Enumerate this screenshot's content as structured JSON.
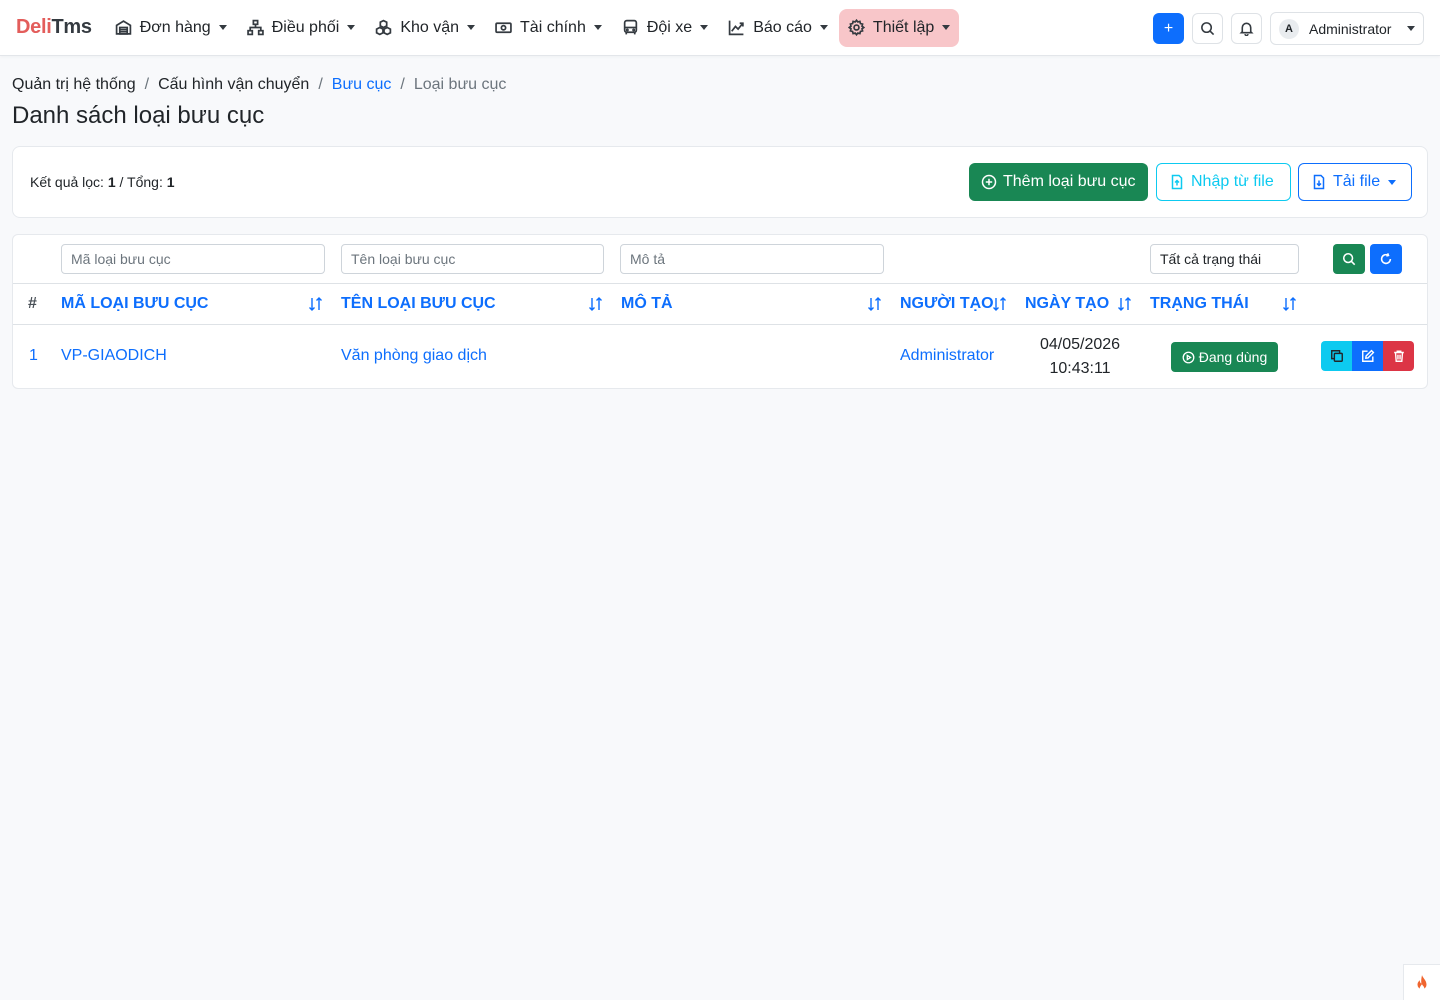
{
  "brand": {
    "part1": "Deli",
    "part2": "Tms"
  },
  "nav": {
    "items": [
      {
        "label": "Đơn hàng",
        "icon": "warehouse-icon"
      },
      {
        "label": "Điều phối",
        "icon": "hierarchy-icon"
      },
      {
        "label": "Kho vận",
        "icon": "boxes-icon"
      },
      {
        "label": "Tài chính",
        "icon": "cash-icon"
      },
      {
        "label": "Đội xe",
        "icon": "bus-icon"
      },
      {
        "label": "Báo cáo",
        "icon": "chart-icon"
      },
      {
        "label": "Thiết lập",
        "icon": "gear-icon",
        "active": true
      }
    ],
    "plus_label": "+",
    "user": {
      "avatar_letter": "A",
      "name": "Administrator"
    }
  },
  "breadcrumb": {
    "items": [
      "Quản trị hệ thống",
      "Cấu hình vận chuyển",
      "Bưu cục",
      "Loại bưu cục"
    ],
    "separator": "/"
  },
  "page_title": "Danh sách loại bưu cục",
  "toolbar": {
    "result_label": "Kết quả lọc:",
    "result_count": "1",
    "total_label": "/ Tổng:",
    "total_count": "1",
    "add_label": "Thêm loại bưu cục",
    "import_label": "Nhập từ file",
    "download_label": "Tải file"
  },
  "filters": {
    "code_placeholder": "Mã loại bưu cục",
    "name_placeholder": "Tên loại bưu cục",
    "desc_placeholder": "Mô tả",
    "status_value": "Tất cả trạng thái"
  },
  "table": {
    "columns": [
      "#",
      "Mã loại bưu cục",
      "Tên loại bưu cục",
      "Mô tả",
      "Người tạo",
      "Ngày tạo",
      "Trạng thái"
    ],
    "rows": [
      {
        "index": "1",
        "code": "VP-GIAODICH",
        "name": "Văn phòng giao dịch",
        "description": "",
        "creator": "Administrator",
        "date": "04/05/2026",
        "time": "10:43:11",
        "status": "Đang dùng"
      }
    ]
  },
  "colors": {
    "primary": "#0d6efd",
    "success": "#198754",
    "info": "#0dcaf0",
    "danger": "#dc3545",
    "brand_red": "#e35d5b",
    "active_nav_bg": "#f8c6c9"
  }
}
